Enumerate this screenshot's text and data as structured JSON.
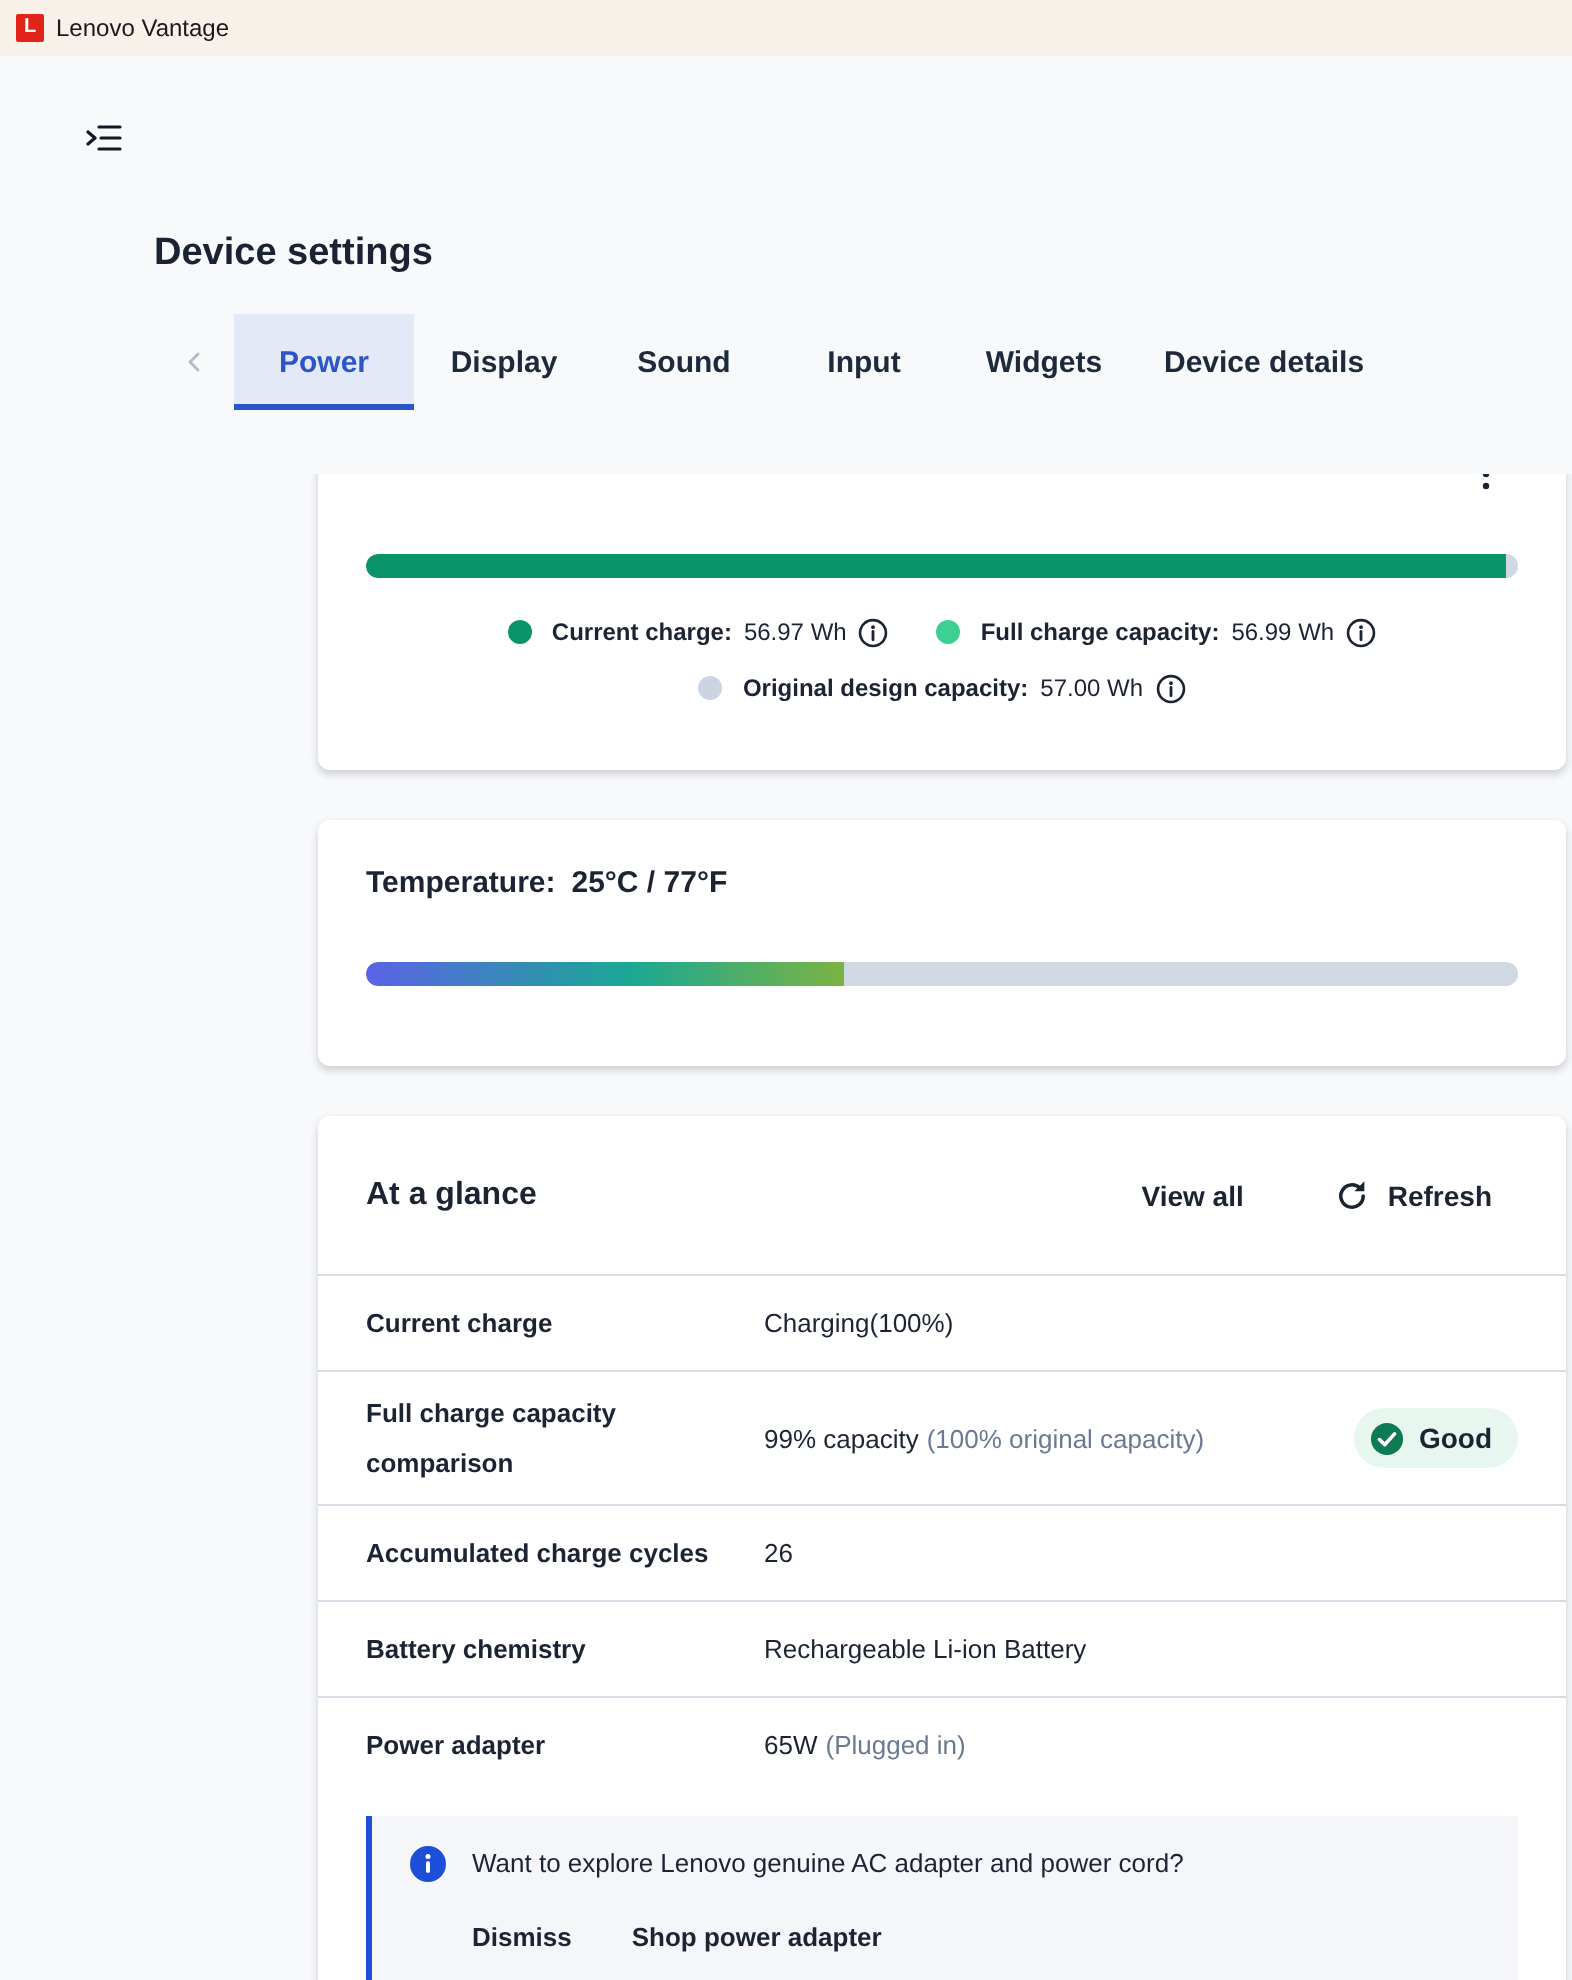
{
  "app": {
    "logo_letter": "L",
    "title": "Lenovo Vantage"
  },
  "page": {
    "title": "Device settings"
  },
  "tab_scroll": {
    "back_disabled": true
  },
  "tabs": [
    {
      "label": "Power",
      "selected": true
    },
    {
      "label": "Display",
      "selected": false
    },
    {
      "label": "Sound",
      "selected": false
    },
    {
      "label": "Input",
      "selected": false
    },
    {
      "label": "Widgets",
      "selected": false
    },
    {
      "label": "Device details",
      "selected": false
    }
  ],
  "battery_health": {
    "bar": {
      "level": 0.99
    },
    "legend": [
      {
        "label": "Current charge:",
        "value": "56.97 Wh",
        "color": "#0a9467"
      },
      {
        "label": "Full charge capacity:",
        "value": "56.99 Wh",
        "color": "#3ecf93"
      },
      {
        "label": "Original design capacity:",
        "value": "57.00 Wh",
        "color": "#cbd5e1"
      }
    ]
  },
  "temperature": {
    "label": "Temperature:",
    "value": "25°C / 77°F",
    "bar": {
      "level": 0.415
    }
  },
  "at_a_glance": {
    "title": "At a glance",
    "actions": [
      {
        "kind": "link",
        "label": "View all"
      },
      {
        "kind": "refresh",
        "label": "Refresh"
      }
    ],
    "rows": [
      {
        "label": "Current charge",
        "value": "Charging(100%)"
      },
      {
        "label": "Full charge capacity comparison",
        "value": "99% capacity",
        "note": "(100% original capacity)",
        "badge": {
          "label": "Good",
          "positive": true
        }
      },
      {
        "label": "Accumulated charge cycles",
        "value": "26"
      },
      {
        "label": "Battery chemistry",
        "value": "Rechargeable Li-ion Battery"
      },
      {
        "label": "Power adapter",
        "value": "65W",
        "note": "(Plugged in)"
      }
    ],
    "banner": {
      "text": "Want to explore Lenovo genuine AC adapter and power cord?",
      "actions": [
        "Dismiss",
        "Shop power adapter"
      ]
    }
  }
}
